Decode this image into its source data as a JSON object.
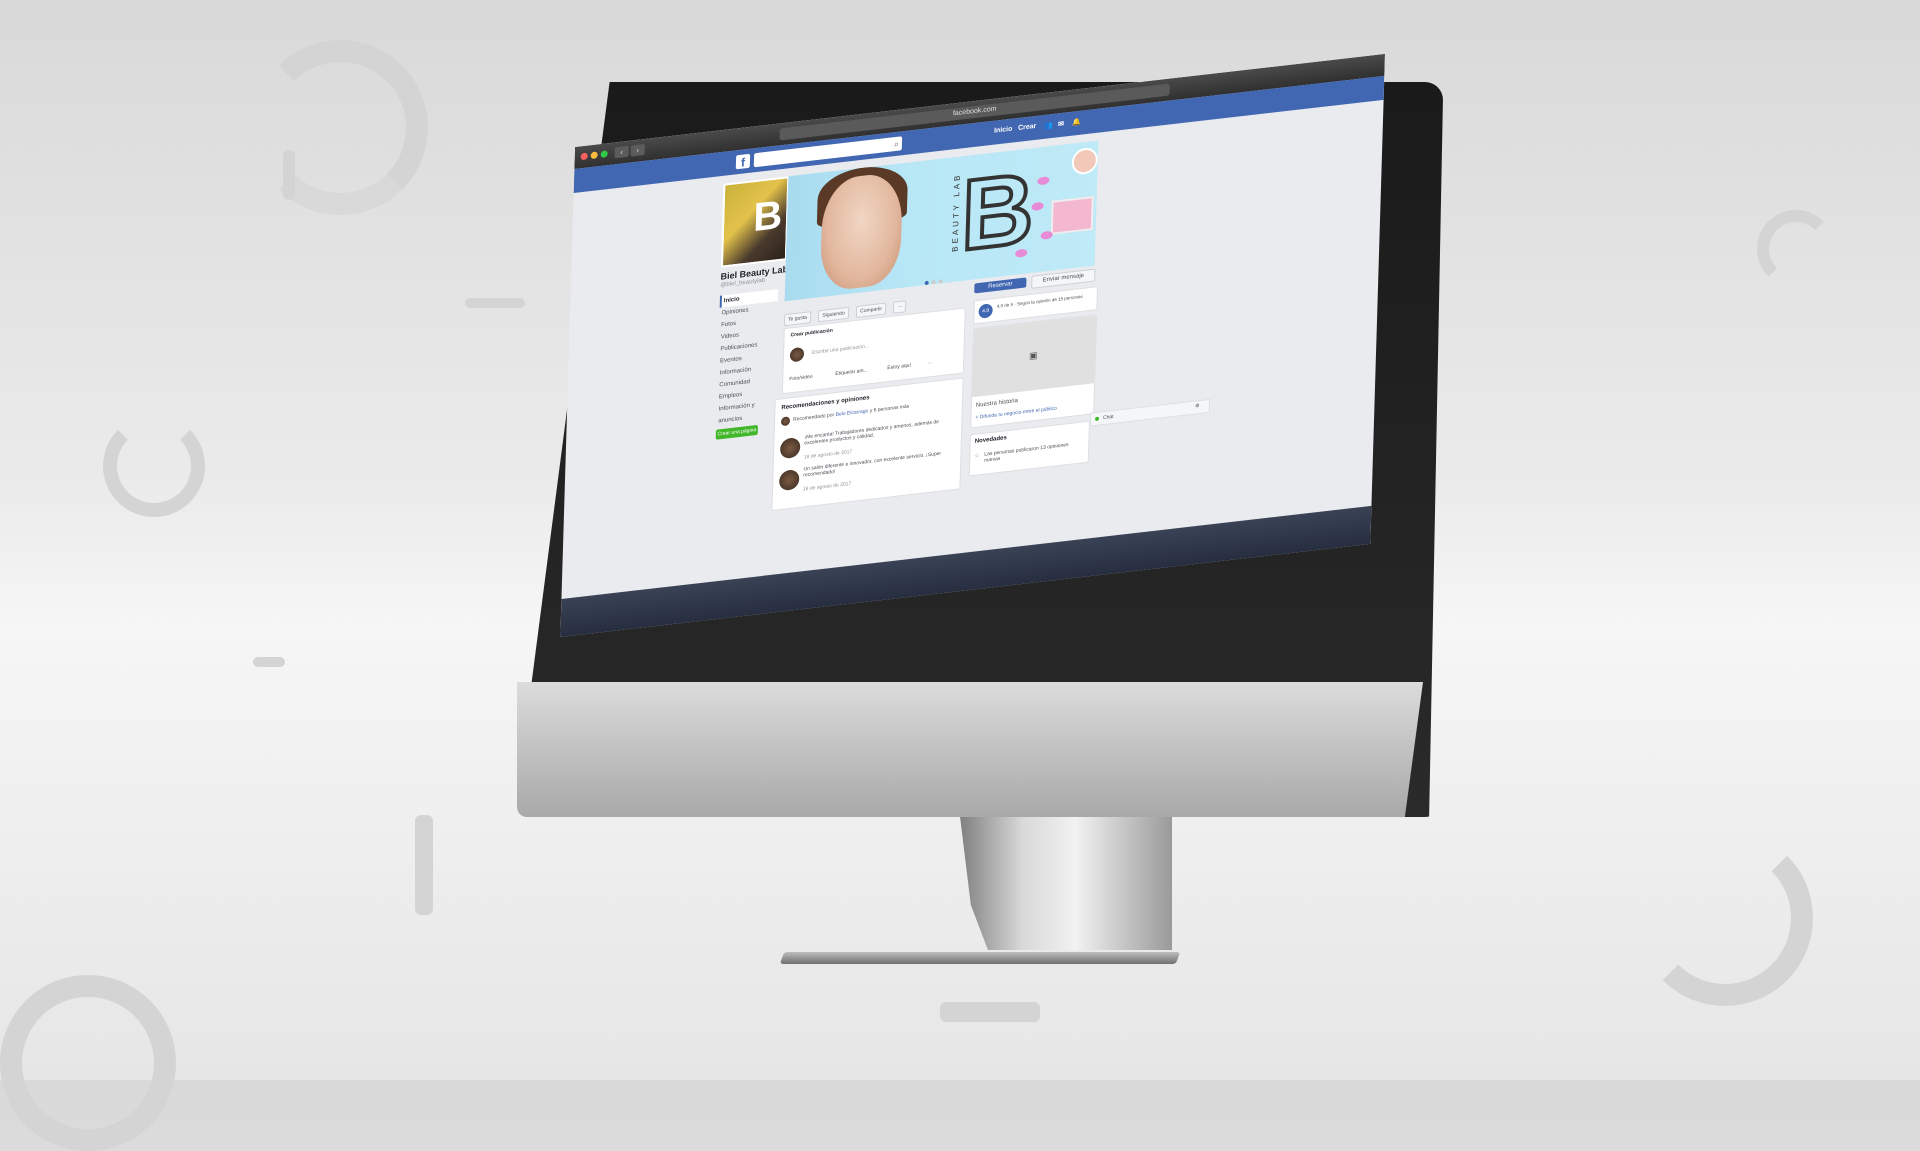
{
  "browser": {
    "url": "facebook.com",
    "back_glyph": "‹",
    "forward_glyph": "›"
  },
  "facebook": {
    "logo": "f",
    "nav": [
      "Inicio",
      "Crear"
    ],
    "page": {
      "name": "Biel Beauty Lab",
      "handle": "@biel_beautylab",
      "menu": [
        "Inicio",
        "Opiniones",
        "Fotos",
        "Videos",
        "Publicaciones",
        "Eventos",
        "Información",
        "Comunidad",
        "Empleos",
        "Información y anuncios"
      ],
      "create_page": "Crear una página"
    },
    "cover": {
      "brand_letter": "B",
      "brand_text": "BEAUTY LAB"
    },
    "buttons": {
      "reserve": "Reservar",
      "message": "Enviar mensaje",
      "like": "Te gusta",
      "following": "Siguiendo",
      "share": "Compartir",
      "more": "···"
    },
    "composer": {
      "title": "Crear publicación",
      "placeholder": "Escribe una publicación...",
      "photo_video": "Foto/video",
      "tag": "Etiquetar am...",
      "checkin": "Estoy aquí",
      "more": "···"
    },
    "reviews": {
      "title": "Recomendaciones y opiniones",
      "recommended_prefix": "Recomendado por",
      "recommended_name": "Belo Elcarrago",
      "recommended_suffix": "y 6 personas más",
      "items": [
        {
          "text": "¡Me encanta! Trabajadores dedicados y amenos, además de excelentes productos y calidad.",
          "date": "18 de agosto de 2017"
        },
        {
          "text": "Un salón diferente e innovador, con excelente servicio. ¡Super recomendado!",
          "date": "18 de agosto de 2017"
        }
      ]
    },
    "sidebar": {
      "rating_badge": "4.9",
      "rating_text": "4,9 de 5 · Según la opinión de 15 personas",
      "story_title": "Nuestra historia",
      "story_link": "+ Difunde tu negocio entre el público",
      "news_title": "Novedades",
      "news_text": "Las personas publicaron 13 opiniones nuevas"
    },
    "chat": {
      "label": "Chat"
    }
  },
  "colors": {
    "facebook_blue": "#4267b2",
    "page_bg": "#e9ebee",
    "green": "#42b72a"
  }
}
